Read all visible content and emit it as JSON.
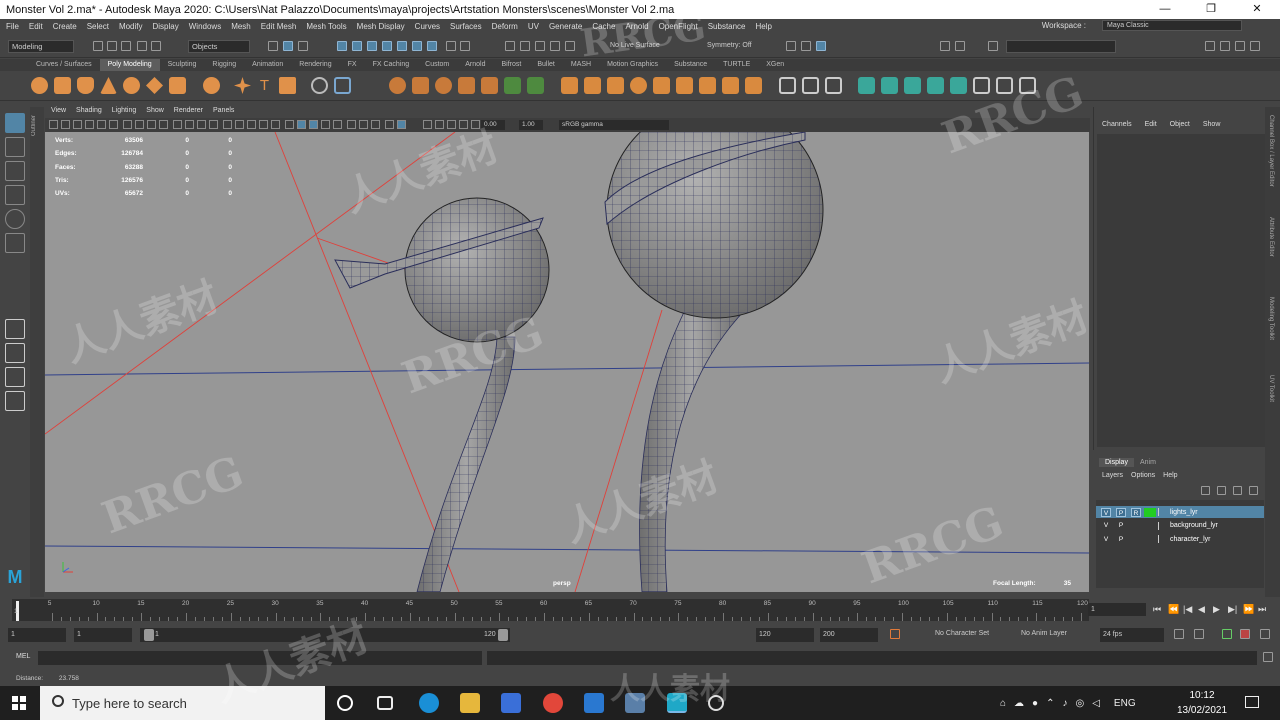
{
  "window": {
    "title": "Monster Vol 2.ma* - Autodesk Maya 2020: C:\\Users\\Nat Palazzo\\Documents\\maya\\projects\\Artstation Monsters\\scenes\\Monster Vol 2.ma",
    "controls": {
      "minimize": "—",
      "restore": "❐",
      "close": "✕"
    }
  },
  "menubar": {
    "items": [
      "File",
      "Edit",
      "Create",
      "Select",
      "Modify",
      "Display",
      "Windows",
      "Mesh",
      "Edit Mesh",
      "Mesh Tools",
      "Mesh Display",
      "Curves",
      "Surfaces",
      "Deform",
      "UV",
      "Generate",
      "Cache",
      "Arnold",
      "OpenFlight",
      "Substance",
      "Help"
    ],
    "workspace_label": "Workspace :",
    "workspace_value": "Maya Classic"
  },
  "statusline": {
    "mode": "Modeling",
    "selection_mask": "Objects",
    "live_surface": "No Live Surface",
    "symmetry": "Symmetry: Off"
  },
  "shelf": {
    "tabs": [
      "Curves / Surfaces",
      "Poly Modeling",
      "Sculpting",
      "Rigging",
      "Animation",
      "Rendering",
      "FX",
      "FX Caching",
      "Custom",
      "Arnold",
      "Bifrost",
      "Bullet",
      "MASH",
      "Motion Graphics",
      "Substance",
      "TURTLE",
      "XGen"
    ],
    "active_tab": "Poly Modeling"
  },
  "outliner_tab": "Outliner",
  "viewport": {
    "menu": [
      "View",
      "Shading",
      "Lighting",
      "Show",
      "Renderer",
      "Panels"
    ],
    "exposure": "0.00",
    "gamma": "1.00",
    "color_space": "sRGB gamma",
    "hud": [
      {
        "label": "Verts:",
        "v1": "63506",
        "v2": "0",
        "v3": "0"
      },
      {
        "label": "Edges:",
        "v1": "126784",
        "v2": "0",
        "v3": "0"
      },
      {
        "label": "Faces:",
        "v1": "63288",
        "v2": "0",
        "v3": "0"
      },
      {
        "label": "Tris:",
        "v1": "126576",
        "v2": "0",
        "v3": "0"
      },
      {
        "label": "UVs:",
        "v1": "65672",
        "v2": "0",
        "v3": "0"
      }
    ],
    "camera": "persp",
    "focal_label": "Focal Length:",
    "focal_value": "35"
  },
  "channel_box": {
    "menu": [
      "Channels",
      "Edit",
      "Object",
      "Show"
    ]
  },
  "side_tabs": [
    "Channel Box / Layer Editor",
    "Attribute Editor",
    "Modeling Toolkit",
    "UV Toolkit"
  ],
  "layer_editor": {
    "tabs": [
      "Display",
      "Anim"
    ],
    "active_tab": "Display",
    "menu": [
      "Layers",
      "Options",
      "Help"
    ],
    "layers": [
      {
        "v": "V",
        "p": "P",
        "r": "R",
        "name": "lights_lyr",
        "color": "#22cc22",
        "selected": true
      },
      {
        "v": "V",
        "p": "P",
        "r": "",
        "name": "background_lyr",
        "color": "",
        "selected": false
      },
      {
        "v": "V",
        "p": "P",
        "r": "",
        "name": "character_lyr",
        "color": "",
        "selected": false
      }
    ]
  },
  "time_slider": {
    "ticks": [
      "5",
      "10",
      "15",
      "20",
      "25",
      "30",
      "35",
      "40",
      "45",
      "50",
      "55",
      "60",
      "65",
      "70",
      "75",
      "80",
      "85",
      "90",
      "95",
      "100",
      "105",
      "110",
      "115",
      "120"
    ],
    "start_tick": "1",
    "current_frame": "1",
    "playback": [
      "⏮",
      "⏪",
      "|◀",
      "◀",
      "▶",
      "▶|",
      "⏩",
      "⏭"
    ]
  },
  "range_slider": {
    "start": "1",
    "playback_start": "1",
    "range_inner_start": "1",
    "range_inner_end": "120",
    "playback_end": "120",
    "end": "200",
    "character_set": "No Character Set",
    "anim_layer": "No Anim Layer",
    "fps": "24 fps"
  },
  "command_line": {
    "label": "MEL"
  },
  "help_line": {
    "label": "Distance:",
    "value": "23.758"
  },
  "taskbar": {
    "search_placeholder": "Type here to search",
    "language": "ENG",
    "time": "10:12",
    "date": "13/02/2021"
  },
  "watermarks": [
    "RRCG",
    "人人素材"
  ]
}
